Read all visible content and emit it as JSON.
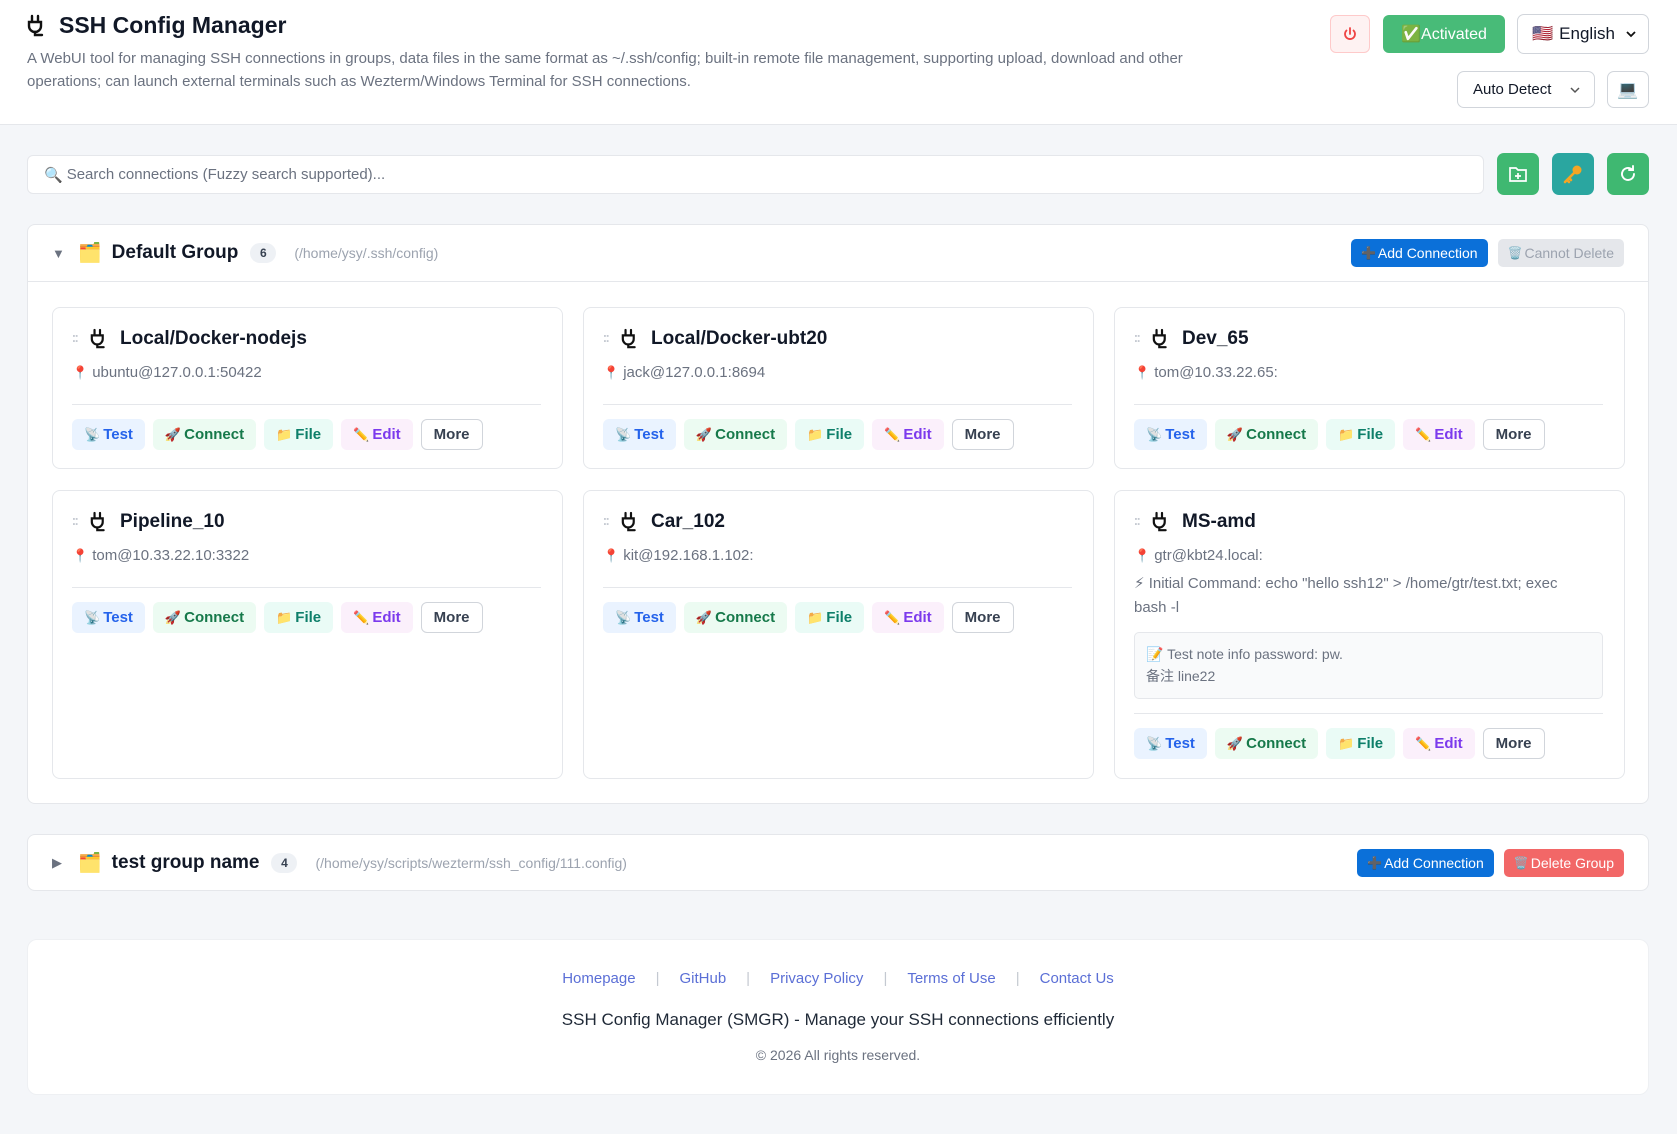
{
  "header": {
    "title": "SSH Config Manager",
    "description": "A WebUI tool for managing SSH connections in groups, data files in the same format as ~/.ssh/config; built-in remote file management, supporting upload, download and other operations; can launch external terminals such as Wezterm/Windows Terminal for SSH connections.",
    "power_icon": "power-icon",
    "activated_label": "✅Activated",
    "language_flag": "🇺🇸",
    "language_label": "English",
    "theme_label": "Auto Detect",
    "terminal_icon": "💻"
  },
  "search": {
    "icon": "🔍",
    "placeholder": "Search connections (Fuzzy search supported)..."
  },
  "groups": [
    {
      "name": "Default Group",
      "icon": "🗂️",
      "toggle": "▼",
      "count": "6",
      "path": "(/home/ysy/.ssh/config)",
      "add_label": "Add Connection",
      "delete_label": "Cannot Delete",
      "connections": [
        {
          "name": "Local/Docker-nodejs",
          "host": "ubuntu@127.0.0.1:50422"
        },
        {
          "name": "Local/Docker-ubt20",
          "host": "jack@127.0.0.1:8694"
        },
        {
          "name": "Dev_65",
          "host": "tom@10.33.22.65:"
        },
        {
          "name": "Pipeline_10",
          "host": "tom@10.33.22.10:3322"
        },
        {
          "name": "Car_102",
          "host": "kit@192.168.1.102:"
        },
        {
          "name": "MS-amd",
          "host": "gtr@kbt24.local:",
          "command": "⚡ Initial Command: echo \"hello ssh12\" > /home/gtr/test.txt; exec bash -l",
          "note_line1": "📝 Test note info password: pw.",
          "note_line2": "备注 line22"
        }
      ]
    },
    {
      "name": "test group name",
      "icon": "🗂️",
      "toggle": "▶",
      "count": "4",
      "path": "(/home/ysy/scripts/wezterm/ssh_config/111.config)",
      "add_label": "Add Connection",
      "delete_label": "Delete Group"
    }
  ],
  "actions": {
    "test": "Test",
    "connect": "Connect",
    "file": "File",
    "edit": "Edit",
    "more": "More",
    "test_icon": "📡",
    "connect_icon": "🚀",
    "file_icon": "📁",
    "edit_icon": "✏️",
    "add_icon": "➕",
    "delete_icon": "🗑️",
    "pin_icon": "📍"
  },
  "footer": {
    "links": [
      "Homepage",
      "GitHub",
      "Privacy Policy",
      "Terms of Use",
      "Contact Us"
    ],
    "tagline": "SSH Config Manager (SMGR) - Manage your SSH connections efficiently",
    "copyright": "© 2026 All rights reserved."
  },
  "colors": {
    "primary_blue": "#0b70d9",
    "activated_green": "#48bb78",
    "delete_red": "#f26767",
    "tool_green": "#3fb871",
    "tool_teal": "#2aa6a0"
  }
}
